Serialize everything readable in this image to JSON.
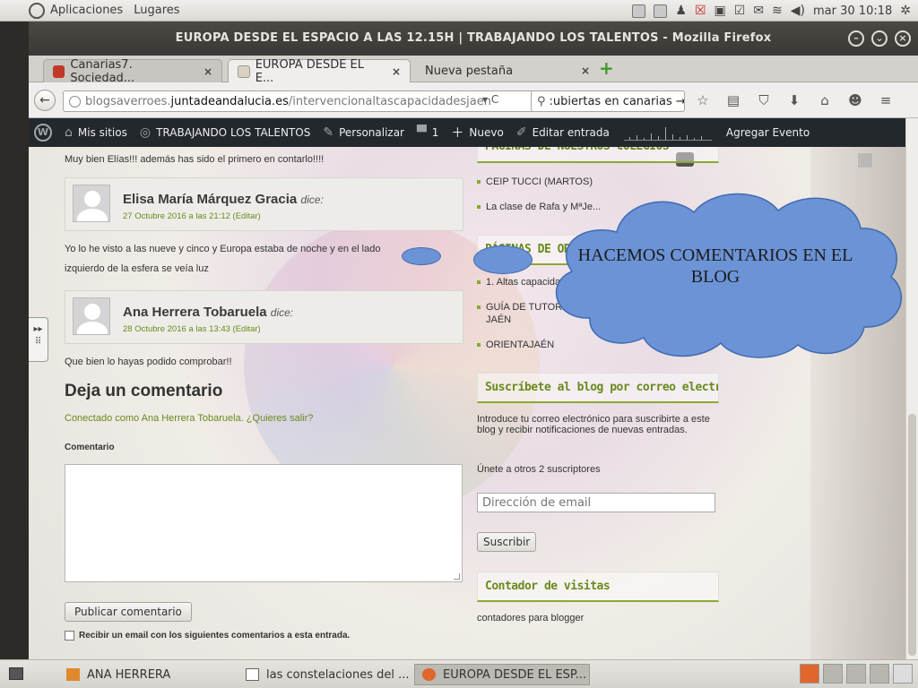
{
  "panel": {
    "menu_apps": "Aplicaciones",
    "menu_places": "Lugares",
    "clock": "mar 30 10:18"
  },
  "window": {
    "title": "EUROPA DESDE EL ESPACIO A LAS 12.15H | TRABAJANDO LOS TALENTOS - Mozilla Firefox"
  },
  "tabs": [
    {
      "label": "Canarias7. Sociedad...",
      "close": "×",
      "favicon_color": "#c0392b"
    },
    {
      "label": "EUROPA DESDE EL E...",
      "close": "×",
      "favicon_color": "#d9d2c0"
    },
    {
      "label": "Nueva pestaña",
      "close": "×"
    }
  ],
  "newtab": "+",
  "navbar": {
    "back": "←",
    "url_prefix": "blogsaverroes.",
    "url_domain": "juntadeandalucia.es",
    "url_path": "/intervencionaltascapacidadesjaen",
    "url_drop": "▾ C",
    "search_value": ":ubiertas en canarias →"
  },
  "wpbar": {
    "logo": "W",
    "my_sites": "Mis sitios",
    "site_name": "TRABAJANDO LOS TALENTOS",
    "customize": "Personalizar",
    "comments_count": "1",
    "new": "Nuevo",
    "edit_entry": "Editar entrada",
    "add_event": "Agregar Evento"
  },
  "content": {
    "top_comment_text": "Muy bien Elías!!! además has sido el primero en contarlo!!!!",
    "comments": [
      {
        "author": "Elisa María Márquez Gracia",
        "says": "dice:",
        "date": "27 Octubre 2016 a las 21:12",
        "edit": "(Editar)",
        "text_line1": "Yo lo he visto a las nueve y cinco y Europa estaba de noche y en el lado",
        "text_line2": "izquierdo de la esfera se veía luz"
      },
      {
        "author": "Ana Herrera Tobaruela",
        "says": "dice:",
        "date": "28 Octubre 2016 a las 13:43",
        "edit": "(Editar)",
        "text_line1": "Que bien lo hayas podido comprobar!!"
      }
    ],
    "reply_title": "Deja un comentario",
    "logged_in": "Conectado como Ana Herrera Tobaruela. ¿Quieres salir?",
    "comment_label": "Comentario",
    "publish_button": "Publicar comentario",
    "notify_label": "Recibir un email con los siguientes comentarios a esta entrada."
  },
  "sidebar": {
    "schools_title": "PÁGINAS DE NUESTROS COLEGIOS",
    "schools": [
      "CEIP TUCCI (MARTOS)",
      "La clase de Rafa y MªJe..."
    ],
    "orientation_title": "PÁGINAS DE ORIENTACIÓN",
    "orientation_items": [
      "1. Altas capacidades",
      "GUÍA DE TUTORÍA",
      "JAÉN",
      "ORIENTAJAÉN"
    ],
    "subscribe_title": "Suscríbete al blog por correo electrónico",
    "subscribe_text": "Introduce tu correo electrónico para suscribirte a este blog y recibir notificaciones de nuevas entradas.",
    "subscribers_text": "Únete a otros 2 suscriptores",
    "email_placeholder": "Dirección de email",
    "subscribe_button": "Suscribir",
    "visits_title": "Contador de visitas",
    "visits_text": "contadores para blogger"
  },
  "overlay": {
    "cloud_text": "HACEMOS COMENTARIOS EN EL BLOG"
  },
  "taskbar": [
    {
      "label": "ANA HERRERA",
      "icon_color": "#e0892c"
    },
    {
      "label": "las constelaciones del ...",
      "icon_color": "#666"
    },
    {
      "label": "EUROPA DESDE EL ESP...",
      "icon_color": "#e0662c"
    }
  ]
}
